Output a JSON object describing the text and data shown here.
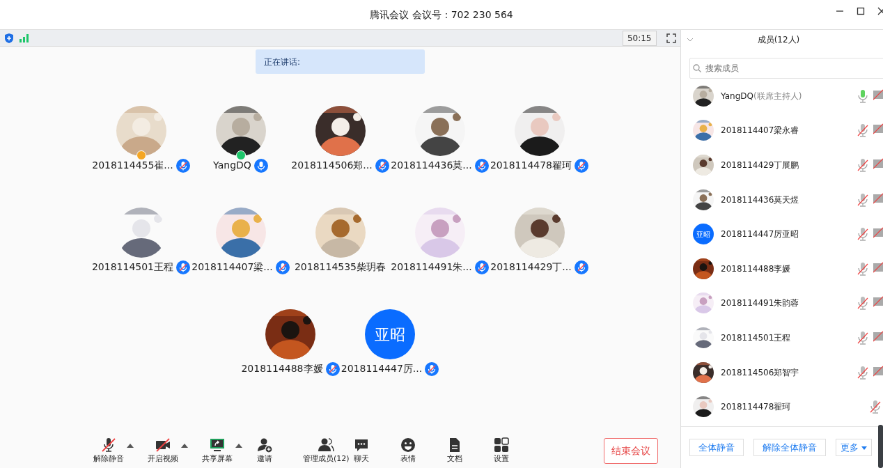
{
  "window": {
    "title": "腾讯会议 会议号：702 230 564"
  },
  "top_bar": {
    "timer": "50:15"
  },
  "speaking": {
    "label": "正在讲话:"
  },
  "participants": [
    {
      "name": "2018114455崔...",
      "color": "#f5a623",
      "mic_icon": true,
      "muted": true
    },
    {
      "name": "YangDQ",
      "color": "#1ec66b",
      "mic_icon": true,
      "muted": false
    },
    {
      "name": "2018114506郑...",
      "mic_icon": true,
      "muted": true
    },
    {
      "name": "2018114436莫...",
      "mic_icon": true,
      "muted": true
    },
    {
      "name": "2018114478翟珂",
      "mic_icon": true,
      "muted": true
    },
    {
      "name": "2018114501王程",
      "mic_icon": true,
      "muted": true
    },
    {
      "name": "2018114407梁...",
      "mic_icon": true,
      "muted": true
    },
    {
      "name": "2018114535柴玥春",
      "mic_icon": false
    },
    {
      "name": "2018114491朱...",
      "mic_icon": true,
      "muted": true
    },
    {
      "name": "2018114429丁...",
      "mic_icon": true,
      "muted": true
    },
    {
      "name": "2018114488李媛",
      "mic_icon": true,
      "muted": true
    },
    {
      "name": "2018114447厉...",
      "avatar": {
        "kind": "text",
        "text": "亚昭"
      },
      "mic_icon": true,
      "muted": true
    }
  ],
  "toolbar": [
    {
      "kind": "mic",
      "label": "解除静音",
      "off": true,
      "caret": true
    },
    {
      "kind": "video",
      "label": "开启视频",
      "off": true,
      "caret": true
    },
    {
      "kind": "share",
      "label": "共享屏幕",
      "caret": true
    },
    {
      "kind": "invite",
      "label": "邀请"
    },
    {
      "kind": "members",
      "label": "管理成员(12)"
    },
    {
      "kind": "chat",
      "label": "聊天"
    },
    {
      "kind": "emoji",
      "label": "表情"
    },
    {
      "kind": "docs",
      "label": "文档"
    },
    {
      "kind": "settings",
      "label": "设置"
    }
  ],
  "end_button": "结束会议",
  "members_panel": {
    "title": "成员(12人)",
    "search_placeholder": "搜索成员",
    "members": [
      {
        "name": "YangDQ",
        "role_note": "(联席主持人)",
        "muted": false,
        "video_icon": true
      },
      {
        "name": "2018114407梁永睿",
        "muted": true,
        "video_icon": true
      },
      {
        "name": "2018114429丁展鹏",
        "muted": true,
        "video_icon": true
      },
      {
        "name": "2018114436莫天煜",
        "muted": true,
        "video_icon": true
      },
      {
        "name": "2018114447厉亚昭",
        "avatar": {
          "kind": "text",
          "text": "亚昭"
        },
        "muted": true,
        "video_icon": true
      },
      {
        "name": "2018114488李媛",
        "muted": true,
        "video_icon": true
      },
      {
        "name": "2018114491朱韵蓉",
        "muted": true,
        "video_icon": true
      },
      {
        "name": "2018114501王程",
        "muted": true,
        "video_icon": true
      },
      {
        "name": "2018114506郑智宇",
        "muted": true,
        "video_icon": true
      },
      {
        "name": "2018114478翟珂",
        "muted": true,
        "video_icon": false
      }
    ],
    "buttons": [
      "全体静音",
      "解除全体静音",
      "更多"
    ]
  }
}
